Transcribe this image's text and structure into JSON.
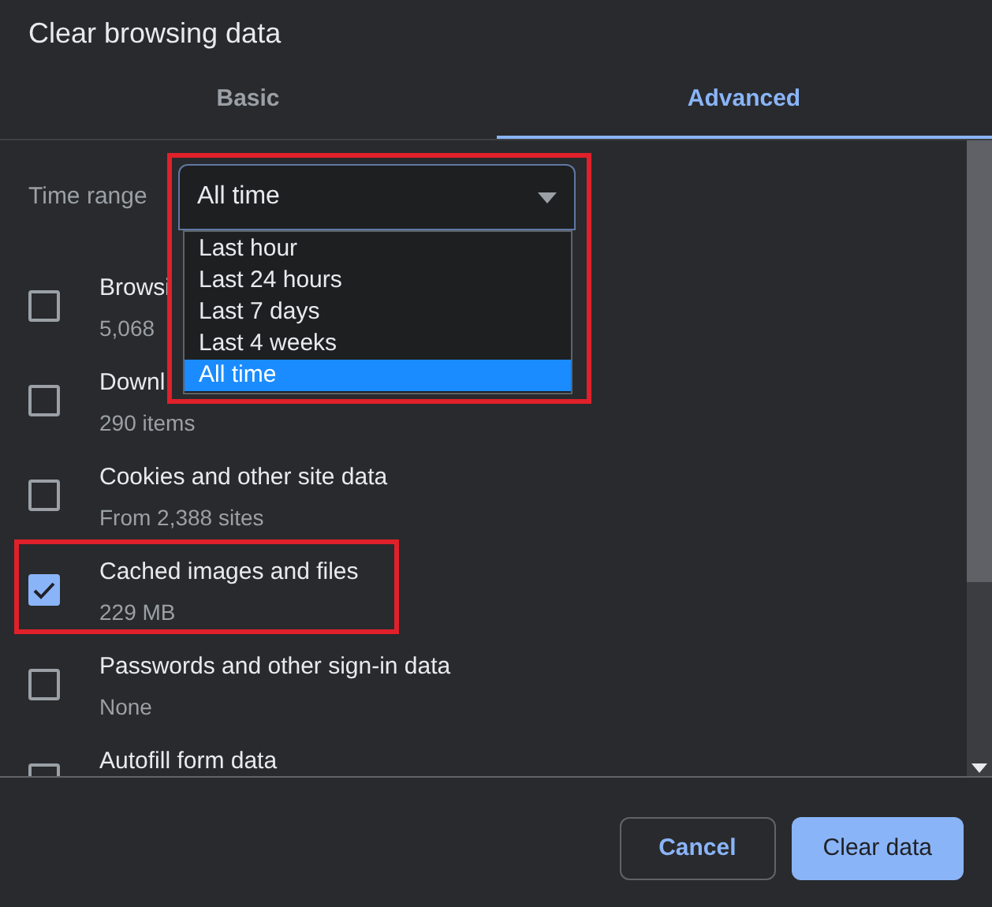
{
  "dialog": {
    "title": "Clear browsing data"
  },
  "tabs": [
    {
      "label": "Basic",
      "selected": false
    },
    {
      "label": "Advanced",
      "selected": true
    }
  ],
  "time_range": {
    "label": "Time range",
    "value": "All time",
    "highlighted": true,
    "expanded": true,
    "options": [
      {
        "label": "Last hour",
        "selected": false
      },
      {
        "label": "Last 24 hours",
        "selected": false
      },
      {
        "label": "Last 7 days",
        "selected": false
      },
      {
        "label": "Last 4 weeks",
        "selected": false
      },
      {
        "label": "All time",
        "selected": true
      }
    ]
  },
  "items": [
    {
      "title": "Browsi",
      "detail": "5,068",
      "checked": false,
      "highlighted": false
    },
    {
      "title": "Downl",
      "detail": "290 items",
      "checked": false,
      "highlighted": false
    },
    {
      "title": "Cookies and other site data",
      "detail": "From 2,388 sites",
      "checked": false,
      "highlighted": false
    },
    {
      "title": "Cached images and files",
      "detail": "229 MB",
      "checked": true,
      "highlighted": true
    },
    {
      "title": "Passwords and other sign-in data",
      "detail": "None",
      "checked": false,
      "highlighted": false
    },
    {
      "title": "Autofill form data",
      "checked": false,
      "highlighted": false
    }
  ],
  "buttons": [
    {
      "label": "Cancel",
      "kind": "secondary"
    },
    {
      "label": "Clear data",
      "kind": "primary"
    }
  ]
}
